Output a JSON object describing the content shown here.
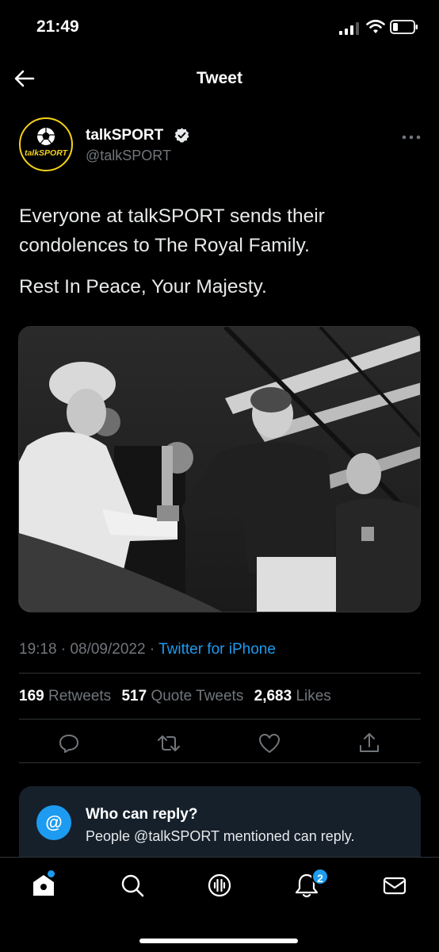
{
  "status_bar": {
    "time": "21:49"
  },
  "header": {
    "title": "Tweet"
  },
  "author": {
    "display_name": "talkSPORT",
    "handle": "@talkSPORT",
    "avatar_text": "talkSPORT",
    "verified": true
  },
  "tweet": {
    "text_line1": "Everyone at talkSPORT sends their condolences to The Royal Family.",
    "text_line2": "Rest In Peace, Your Majesty."
  },
  "meta": {
    "time": "19:18",
    "date": "08/09/2022",
    "separator": "·",
    "source": "Twitter for iPhone"
  },
  "stats": {
    "retweets_count": "169",
    "retweets_label": "Retweets",
    "quotes_count": "517",
    "quotes_label": "Quote Tweets",
    "likes_count": "2,683",
    "likes_label": "Likes"
  },
  "reply_card": {
    "icon": "@",
    "title": "Who can reply?",
    "description": "People @talkSPORT mentioned can reply."
  },
  "tabbar": {
    "notifications_badge": "2"
  },
  "icons": {
    "back": "arrow-left-icon",
    "more": "more-horizontal-icon",
    "verified": "verified-badge-icon",
    "reply": "reply-icon",
    "retweet": "retweet-icon",
    "like": "heart-icon",
    "share": "share-icon",
    "home": "home-icon",
    "search": "search-icon",
    "spaces": "spaces-icon",
    "notifications": "bell-icon",
    "messages": "mail-icon"
  },
  "colors": {
    "accent": "#1d9bf0",
    "background": "#000000",
    "muted": "#71767b",
    "card": "#15202b",
    "brand_yellow": "#f6d21a"
  }
}
